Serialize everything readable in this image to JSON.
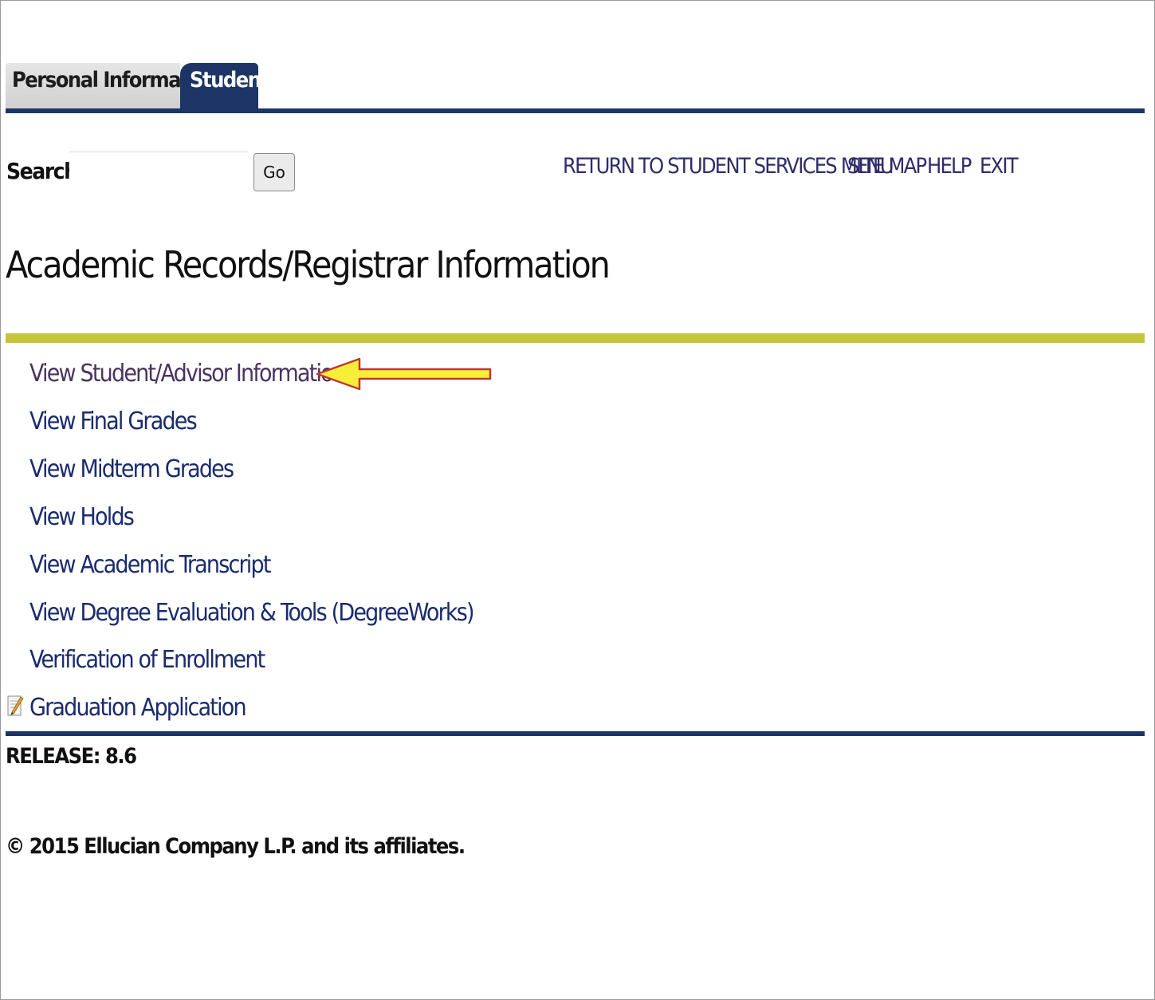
{
  "tabs": [
    {
      "label": "Personal Information",
      "active": false
    },
    {
      "label": "Student",
      "active": true
    }
  ],
  "search": {
    "label": "Search",
    "value": "",
    "button_label": "Go"
  },
  "nav_links": [
    {
      "label": "RETURN TO STUDENT SERVICES MENU"
    },
    {
      "label": "SITE MAP"
    },
    {
      "label": "HELP"
    },
    {
      "label": "EXIT"
    }
  ],
  "page_title": "Academic Records/Registrar Information",
  "menu": [
    {
      "label": "View Student/Advisor Information",
      "visited": true,
      "highlighted": true
    },
    {
      "label": "View Final Grades"
    },
    {
      "label": "View Midterm Grades"
    },
    {
      "label": "View Holds"
    },
    {
      "label": "View Academic Transcript"
    },
    {
      "label": "View Degree Evaluation & Tools (DegreeWorks)"
    },
    {
      "label": "Verification of Enrollment"
    },
    {
      "label": "Graduation Application",
      "icon": "document-edit-icon"
    }
  ],
  "footer": {
    "release": "RELEASE: 8.6",
    "copyright": "© 2015 Ellucian Company L.P. and its affiliates."
  },
  "colors": {
    "tab_active": "#1c3566",
    "accent_rule": "#c6c53a",
    "link": "#1a2b6e",
    "visited_link": "#4a3360",
    "arrow_fill": "#f7ee3a",
    "arrow_stroke": "#c0392b"
  }
}
